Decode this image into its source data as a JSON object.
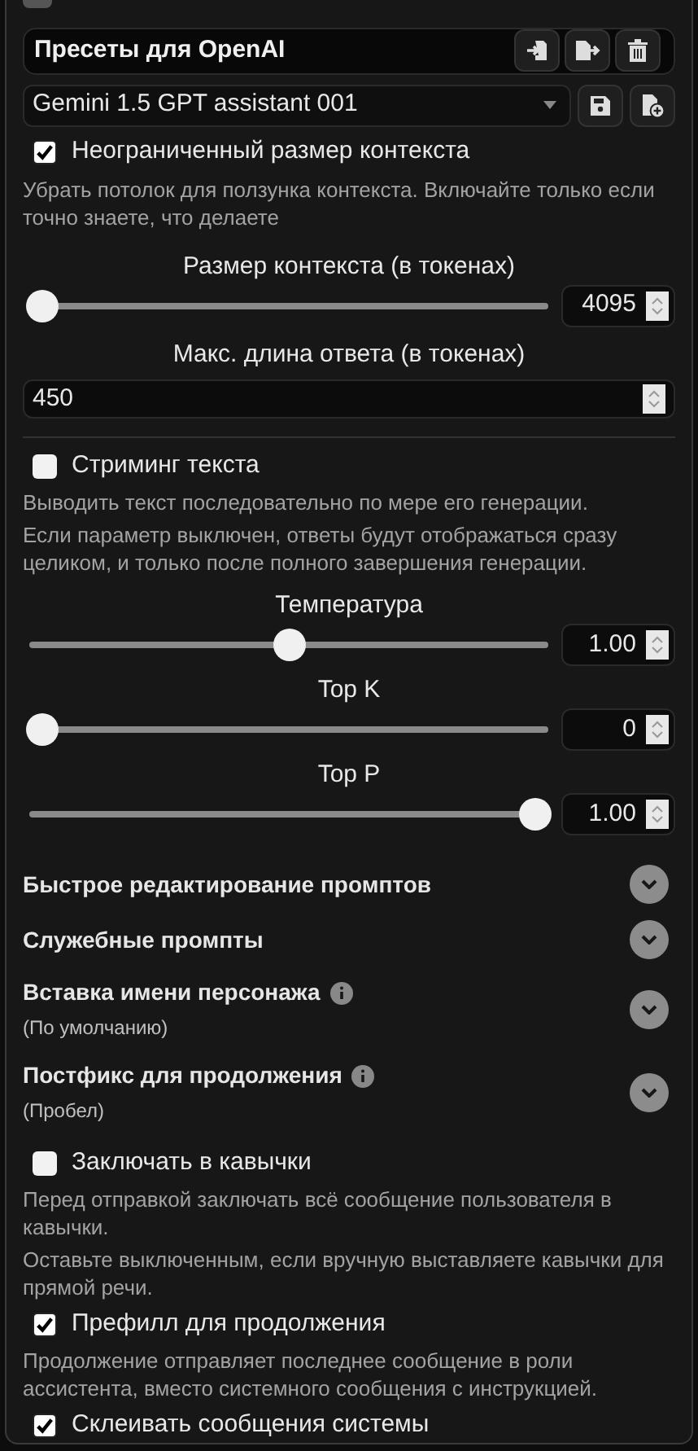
{
  "presets": {
    "title": "Пресеты для OpenAI",
    "selected": "Gemini 1.5 GPT assistant 001"
  },
  "unlimited_context": {
    "label": "Неограниченный размер контекста",
    "checked": true,
    "hints": [
      "Убрать потолок для ползунка контекста. Включайте только если точно знаете, что делаете"
    ]
  },
  "context_size": {
    "label": "Размер контекста (в токенах)",
    "level": 0,
    "value": "4095"
  },
  "max_response": {
    "label": "Макс. длина ответа (в токенах)",
    "value": "450"
  },
  "streaming": {
    "label": "Стриминг текста",
    "checked": false,
    "hints": [
      "Выводить текст последовательно по мере его генерации.",
      "Если параметр выключен, ответы будут отображаться сразу целиком, и только после полного завершения генерации."
    ]
  },
  "samplers": [
    {
      "label": "Температура",
      "level": 0.5,
      "value": "1.00"
    },
    {
      "label": "Top K",
      "level": 0,
      "value": "0"
    },
    {
      "label": "Top P",
      "level": 1,
      "value": "1.00"
    }
  ],
  "sections": [
    {
      "title": "Быстрое редактирование промптов",
      "info": false
    },
    {
      "title": "Служебные промпты",
      "info": false
    },
    {
      "title": "Вставка имени персонажа",
      "info": true,
      "subtitle": "(По умолчанию)"
    },
    {
      "title": "Постфикс для продолжения",
      "info": true,
      "subtitle": "(Пробел)"
    }
  ],
  "options": [
    {
      "label": "Заключать в кавычки",
      "checked": false,
      "hints": [
        "Перед отправкой заключать всё сообщение пользователя в кавычки.",
        "Оставьте выключенным, если вручную выставляете кавычки для прямой речи."
      ]
    },
    {
      "label": "Префилл для продолжения",
      "checked": true,
      "hints": [
        "Продолжение отправляет последнее сообщение в роли ассистента, вместо системного сообщения с инструкцией."
      ]
    },
    {
      "label": "Склеивать сообщения системы",
      "checked": true
    }
  ]
}
